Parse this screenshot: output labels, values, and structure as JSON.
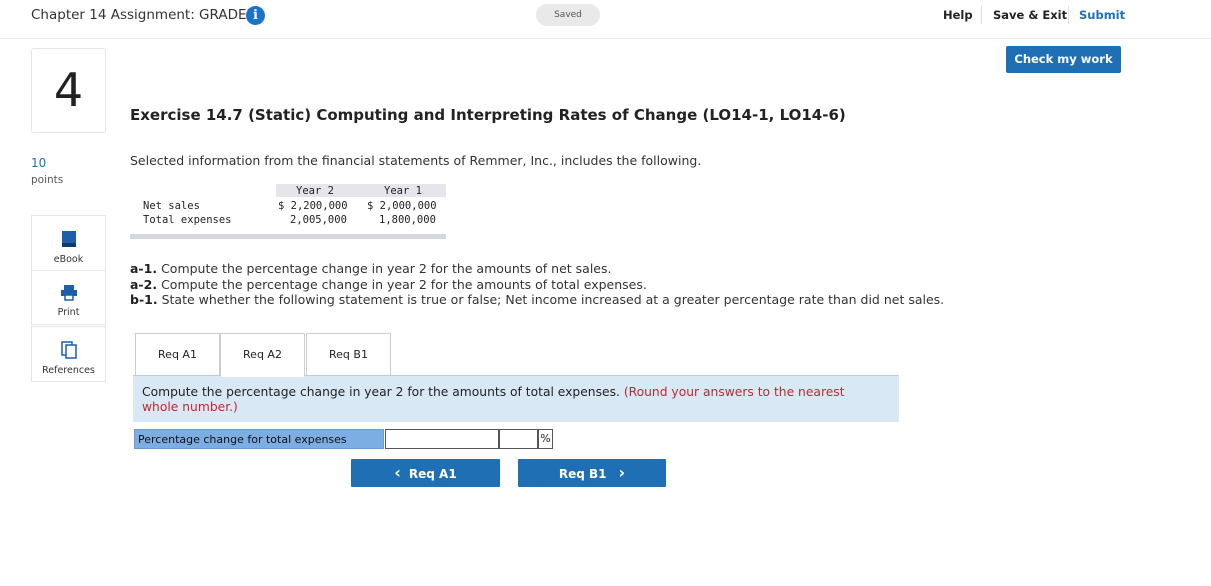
{
  "header": {
    "assignment_title": "Chapter 14 Assignment: GRADED",
    "info_icon": "i",
    "saved_label": "Saved",
    "help_label": "Help",
    "save_exit_label": "Save & Exit",
    "submit_label": "Submit",
    "check_my_work_label": "Check my work"
  },
  "question": {
    "number": "4",
    "points_value": "10",
    "points_label": "points"
  },
  "sidebar": {
    "items": [
      {
        "label": "eBook",
        "icon": "book-icon"
      },
      {
        "label": "Print",
        "icon": "printer-icon"
      },
      {
        "label": "References",
        "icon": "references-icon"
      }
    ]
  },
  "exercise": {
    "title": "Exercise 14.7 (Static) Computing and Interpreting Rates of Change (LO14-1, LO14-6)",
    "intro": "Selected information from the financial statements of Remmer, Inc., includes the following."
  },
  "financial_table": {
    "headers": [
      "Year 2",
      "Year 1"
    ],
    "rows": [
      {
        "label": "Net sales",
        "year2": "$ 2,200,000",
        "year1": "$ 2,000,000"
      },
      {
        "label": "Total expenses",
        "year2": "2,005,000",
        "year1": "1,800,000"
      }
    ]
  },
  "requirements": [
    {
      "id": "a-1.",
      "text": "Compute the percentage change in year 2 for the amounts of net sales."
    },
    {
      "id": "a-2.",
      "text": "Compute the percentage change in year 2 for the amounts of total expenses."
    },
    {
      "id": "b-1.",
      "text": "State whether the following statement is true or false; Net income increased at a greater percentage rate than did net sales."
    }
  ],
  "tabs": [
    {
      "label": "Req A1"
    },
    {
      "label": "Req A2"
    },
    {
      "label": "Req B1"
    }
  ],
  "active_tab": "Req A2",
  "question_box": {
    "text": "Compute the percentage change in year 2 for the amounts of total expenses.",
    "note": "(Round your answers to the nearest whole number.)"
  },
  "answer": {
    "label": "Percentage change for total expenses",
    "value": "",
    "unit": "%"
  },
  "nav": {
    "prev_label": "Req A1",
    "next_label": "Req B1",
    "prev_arrow": "‹",
    "next_arrow": "›"
  },
  "colors": {
    "primary_blue": "#1f6fb4",
    "question_bg": "#d9e8f5",
    "answer_label_bg": "#7daee3",
    "note_red": "#c0292f"
  }
}
